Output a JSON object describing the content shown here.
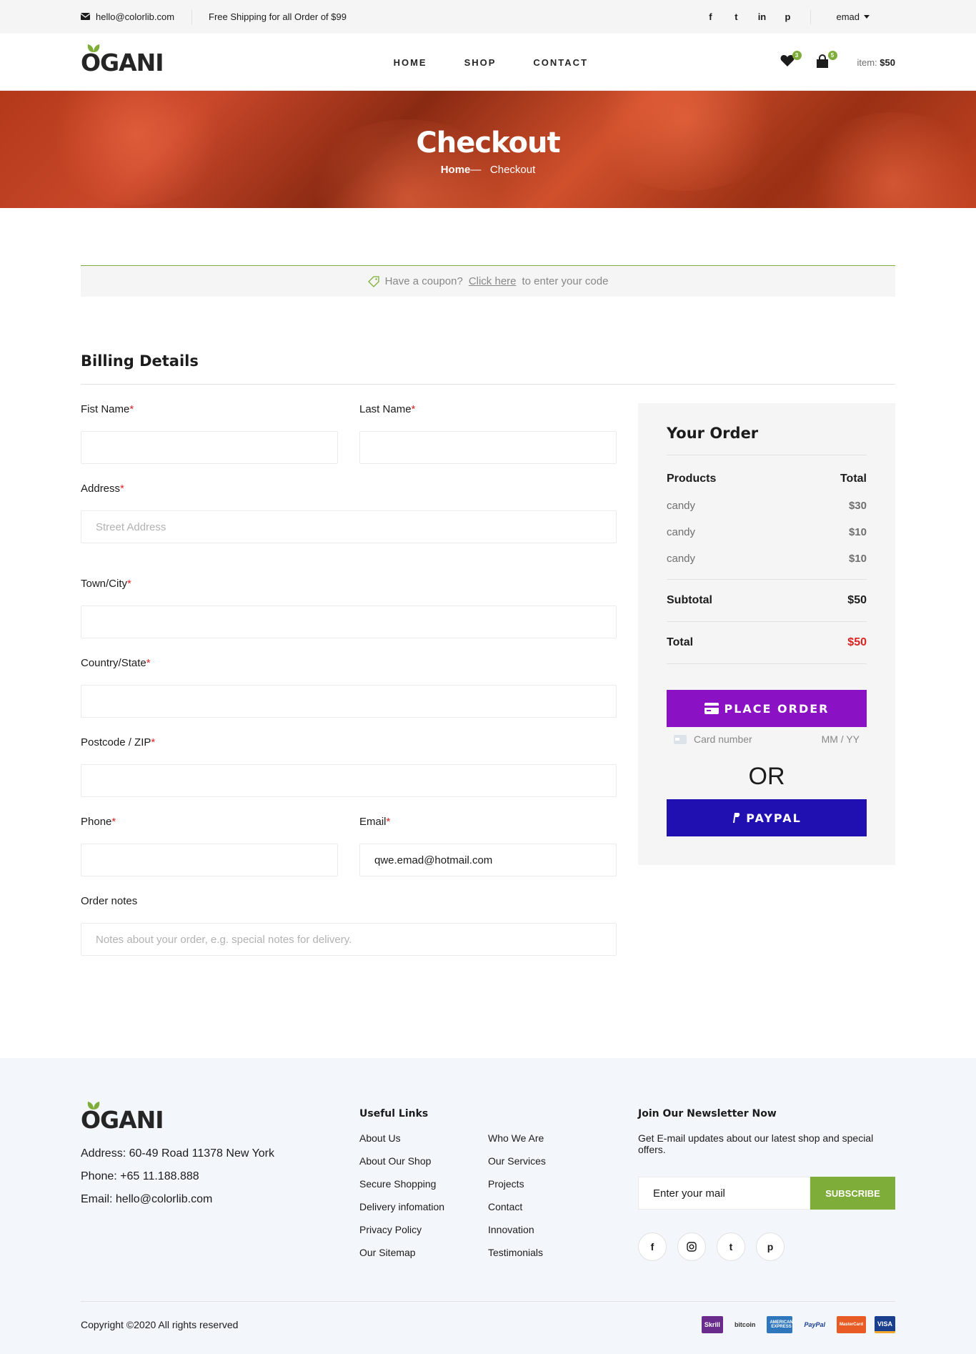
{
  "topbar": {
    "email": "hello@colorlib.com",
    "shipping": "Free Shipping for all Order of $99",
    "social": [
      "f",
      "t",
      "in",
      "p"
    ],
    "user": "emad"
  },
  "header": {
    "logo": "OGANI",
    "nav": [
      "HOME",
      "SHOP",
      "CONTACT"
    ],
    "wishlist_count": "3",
    "cart_count": "5",
    "item_label": "item:",
    "item_total": "$50"
  },
  "hero": {
    "title": "Checkout",
    "crumb_home": "Home",
    "crumb_sep": "—",
    "crumb_current": "Checkout"
  },
  "coupon": {
    "prefix": "Have a coupon?",
    "link": "Click here",
    "suffix": "to enter your code"
  },
  "billing": {
    "title": "Billing Details",
    "first_name": "Fist Name",
    "last_name": "Last Name",
    "address": "Address",
    "address_placeholder": "Street Address",
    "town": "Town/City",
    "country": "Country/State",
    "postcode": "Postcode / ZIP",
    "phone": "Phone",
    "email": "Email",
    "email_value": "qwe.emad@hotmail.com",
    "notes": "Order notes",
    "notes_placeholder": "Notes about your order, e.g. special notes for delivery.",
    "required": "*"
  },
  "order": {
    "title": "Your Order",
    "products_label": "Products",
    "total_label": "Total",
    "items": [
      {
        "name": "candy",
        "price": "$30"
      },
      {
        "name": "candy",
        "price": "$10"
      },
      {
        "name": "candy",
        "price": "$10"
      }
    ],
    "subtotal_label": "Subtotal",
    "subtotal": "$50",
    "total_row_label": "Total",
    "total": "$50",
    "place_order": "PLACE ORDER",
    "card_placeholder": "Card number",
    "expiry_placeholder": "MM / YY",
    "or": "OR",
    "paypal": "PAYPAL"
  },
  "footer": {
    "logo": "OGANI",
    "address": "Address: 60-49 Road 11378 New York",
    "phone": "Phone: +65 11.188.888",
    "email": "Email: hello@colorlib.com",
    "links_title": "Useful Links",
    "links_col1": [
      "About Us",
      "About Our Shop",
      "Secure Shopping",
      "Delivery infomation",
      "Privacy Policy",
      "Our Sitemap"
    ],
    "links_col2": [
      "Who We Are",
      "Our Services",
      "Projects",
      "Contact",
      "Innovation",
      "Testimonials"
    ],
    "newsletter_title": "Join Our Newsletter Now",
    "newsletter_text": "Get E-mail updates about our latest shop and special offers.",
    "newsletter_placeholder": "Enter your mail",
    "subscribe": "SUBSCRIBE",
    "copyright": "Copyright ©2020 All rights reserved",
    "payments": [
      "Skrill",
      "bitcoin",
      "AMERICAN EXPRESS",
      "PayPal",
      "MasterCard",
      "VISA"
    ]
  },
  "colors": {
    "accent": "#7fad39",
    "place_order": "#8a12c4",
    "paypal": "#2010b2",
    "required": "#dd2222"
  }
}
